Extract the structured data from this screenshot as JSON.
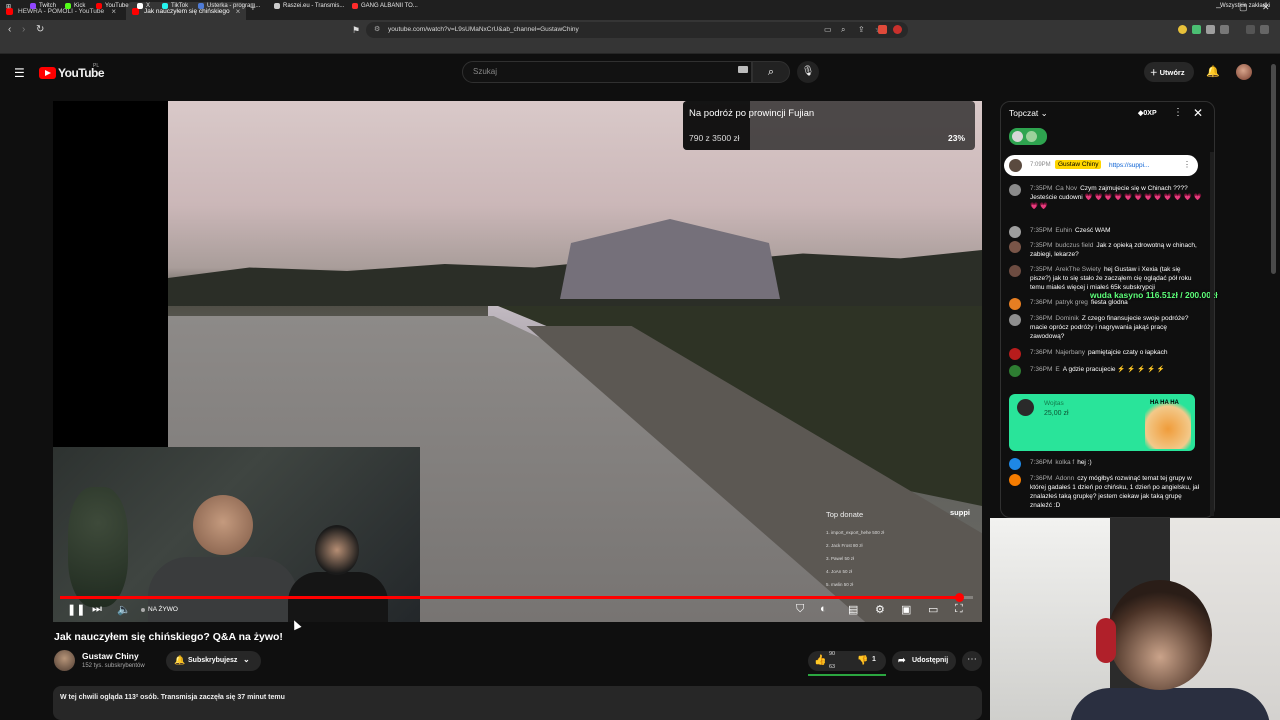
{
  "browser": {
    "tabs": [
      {
        "title": "HEWRA - POMOLI - YouTube"
      },
      {
        "title": "Jak nauczyłem się chińskiego"
      }
    ],
    "url": "youtube.com/watch?v=L9sUMaNxCrU&ab_channel=GustawChiny",
    "bookmarks": [
      "Twitch",
      "Kick",
      "YouTube",
      "X",
      "TikTok",
      "Usterka - program...",
      "Raszei.eu - Transmis...",
      "GANG ALBANII TO..."
    ],
    "bookmarks_folder": "Wszystkie zakładki",
    "bookmark_colors": [
      "#9146ff",
      "#53fc18",
      "#ff0000",
      "#ffffff",
      "#25f4ee",
      "#4e7bd6",
      "#cccccc",
      "#ff2b2b"
    ]
  },
  "youtube": {
    "country_code": "PL",
    "logo_text": "YouTube",
    "search_placeholder": "Szukaj",
    "create_label": "Utwórz"
  },
  "overlay": {
    "goal_title": "Na podróż po prowincji Fujian",
    "goal_amount": "790 z 3500 zł",
    "goal_percent": "23%",
    "goal_fraction": 0.23,
    "top_donate_title": "Top donate",
    "top_donate_rows": [
      "1. import_export_hehe 500 zł",
      "2. Jack Frost 80 zł",
      "3. Pawel 50 zł",
      "4. JoAn 50 zł",
      "5. mwlin 50 zł"
    ],
    "suppi_logo": "suppi",
    "wheel_text": "wuda kasyno 116.51zł / 200.00zł"
  },
  "player": {
    "live_label": "NA ŻYWO",
    "progress_fraction": 0.985
  },
  "video": {
    "title": "Jak nauczyłem się chińskiego? Q&A na żywo!",
    "channel_name": "Gustaw Chiny",
    "channel_subs": "152 tys. subskrybentów",
    "subscribe_label": "Subskrybujesz",
    "like_count_top": "90",
    "like_count_bottom": "63",
    "dislike_count": "1",
    "share_label": "Udostępnij",
    "description_line": "W tej chwili ogląda 113² osób. Transmisja zaczęła się 37 minut temu"
  },
  "chat": {
    "title": "Topczat",
    "xp": "0XP",
    "pinned": {
      "time": "7:09PM",
      "name": "Gustaw Chiny",
      "message": "https://suppi..."
    },
    "messages": [
      {
        "time": "7:35PM",
        "name": "Ca Nov",
        "text": "Czym zajmujecie się w Chinach ???? Jesteście cudowni 💗 💗 💗 💗 💗 💗 💗 💗 💗 💗 💗 💗 💗 💗",
        "color": "#8a8a8a"
      },
      {
        "time": "7:35PM",
        "name": "Euhin",
        "text": "Cześć WAM",
        "color": "#9e9e9e"
      },
      {
        "time": "7:35PM",
        "name": "budczus field",
        "text": "Jak z opieką zdrowotną w chinach, zabiegi, lekarze?",
        "color": "#795548"
      },
      {
        "time": "7:35PM",
        "name": "ArekThe Swiety",
        "text": "hej Gustaw i Xexia (tak się pisze?) jak to się stało że zacząłem cię oglądać pół roku temu miałeś więcej i miałeś 65k subskrypcji",
        "color": "#6d4c41"
      },
      {
        "time": "7:36PM",
        "name": "patryk greg",
        "text": "fiesta glodna",
        "color": "#e67e22"
      },
      {
        "time": "7:36PM",
        "name": "Dominik",
        "text": "Z czego finansujecie swoje podróże? macie oprócz podróży i nagrywania jakąś pracę zawodową?",
        "color": "#8e8e8e"
      },
      {
        "time": "7:36PM",
        "name": "Najerbany",
        "text": "pamiętajcie czaty o łapkach",
        "color": "#b71c1c"
      },
      {
        "time": "7:36PM",
        "name": "E",
        "text": "A gdzie pracujecie ⚡ ⚡ ⚡ ⚡ ⚡",
        "color": "#2e7d32"
      },
      {
        "time": "7:36PM",
        "name": "kolka f",
        "text": "hej :)",
        "color": "#1e88e5"
      },
      {
        "time": "7:36PM",
        "name": "Adonn",
        "text": "czy mógłbyś rozwinąć temat tej grupy w której gadałeś 1 dzień po chińsku, 1 dzień po angielsku, jak znalazłeś taką grupkę? jestem ciekaw jak taką grupę znaleźć :D",
        "color": "#f57c00"
      }
    ],
    "donate": {
      "name": "Wojtas",
      "amount": "25,00 zł",
      "image_text": "HA HA HA"
    }
  }
}
